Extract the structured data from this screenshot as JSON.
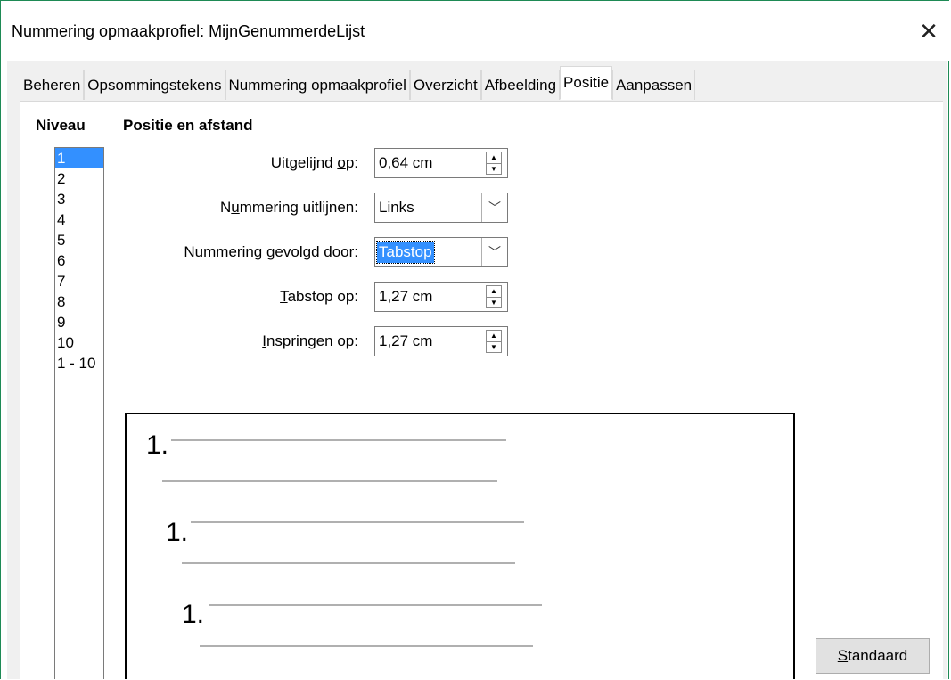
{
  "window": {
    "title": "Nummering opmaakprofiel: MijnGenummerdeLijst",
    "close": "✕"
  },
  "tabs": [
    "Beheren",
    "Opsommingstekens",
    "Nummering opmaakprofiel",
    "Overzicht",
    "Afbeelding",
    "Positie",
    "Aanpassen"
  ],
  "active_tab": "Positie",
  "level": {
    "heading": "Niveau",
    "items": [
      "1",
      "2",
      "3",
      "4",
      "5",
      "6",
      "7",
      "8",
      "9",
      "10",
      "1 - 10"
    ],
    "selected": "1"
  },
  "section": {
    "heading": "Positie en afstand"
  },
  "fields": {
    "aligned_at": {
      "label_pre": "Uitgelijnd ",
      "label_ul": "o",
      "label_post": "p:",
      "value": "0,64 cm"
    },
    "numbering_align": {
      "label_pre": "N",
      "label_ul": "u",
      "label_post": "mmering uitlijnen:",
      "value": "Links"
    },
    "followed_by": {
      "label_pre": "",
      "label_ul": "N",
      "label_post": "ummering gevolgd door:",
      "value": "Tabstop"
    },
    "tab_at": {
      "label_pre": "",
      "label_ul": "T",
      "label_post": "abstop op:",
      "value": "1,27 cm"
    },
    "indent_at": {
      "label_pre": "",
      "label_ul": "I",
      "label_post": "nspringen op:",
      "value": "1,27 cm"
    }
  },
  "preview": {
    "numbers": [
      "1.",
      "1.",
      "1."
    ]
  },
  "buttons": {
    "default_ul": "S",
    "default_rest": "tandaard"
  }
}
